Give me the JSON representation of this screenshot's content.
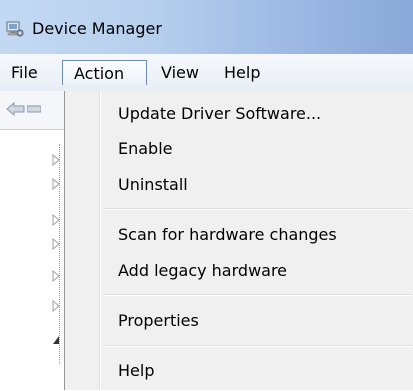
{
  "window": {
    "title": "Device Manager"
  },
  "menubar": {
    "items": [
      {
        "label": "File"
      },
      {
        "label": "Action"
      },
      {
        "label": "View"
      },
      {
        "label": "Help"
      }
    ]
  },
  "action_menu": {
    "items": [
      {
        "label": "Update Driver Software..."
      },
      {
        "label": "Enable"
      },
      {
        "label": "Uninstall"
      },
      {
        "label": "Scan for hardware changes"
      },
      {
        "label": "Add legacy hardware"
      },
      {
        "label": "Properties"
      },
      {
        "label": "Help"
      }
    ]
  },
  "colors": {
    "titlebar_start": "#c3d9f3",
    "titlebar_end": "#8aa9d8",
    "menu_background": "#f0f0f0",
    "highlight_border": "#6d8bb3"
  },
  "icons": {
    "app": "device-manager-icon",
    "back": "back-arrow-icon",
    "forward": "forward-arrow-icon",
    "expand": "expand-triangle-icon"
  }
}
